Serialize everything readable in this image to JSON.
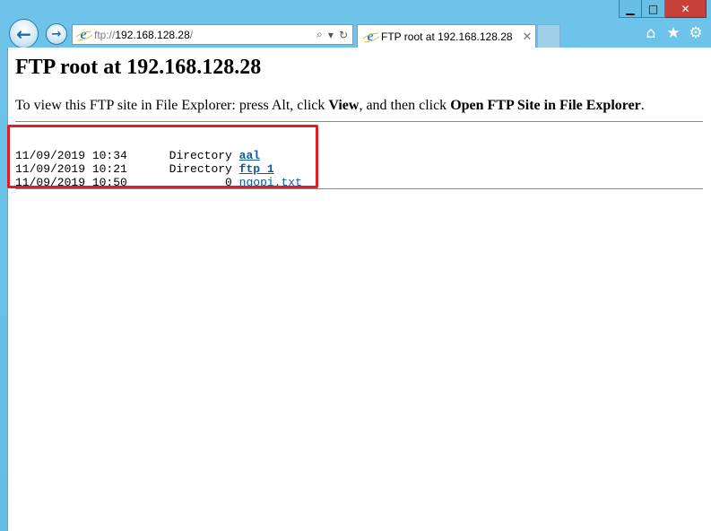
{
  "window": {
    "minimize_label": "▁",
    "maximize_label": "□",
    "close_label": "✕"
  },
  "nav": {
    "back_label": "←",
    "forward_label": "→"
  },
  "address": {
    "prefix": "ftp://",
    "host": "192.168.128.28",
    "suffix": "/",
    "search_glyph": "⌕",
    "dropdown_glyph": "▾",
    "refresh_glyph": "↻"
  },
  "tab": {
    "title": "FTP root at 192.168.128.28",
    "close_glyph": "✕"
  },
  "toolbar_icons": {
    "home": "⌂",
    "favorites": "★",
    "settings": "⚙"
  },
  "page": {
    "title": "FTP root at 192.168.128.28",
    "instr_1": "To view this FTP site in File Explorer: press Alt, click ",
    "instr_view": "View",
    "instr_2": ", and then click ",
    "instr_open": "Open FTP Site in File Explorer",
    "instr_3": "."
  },
  "listing": [
    {
      "date": "11/09/2019 10:34",
      "type": "Directory",
      "name": "aal"
    },
    {
      "date": "11/09/2019 10:21",
      "type": "Directory",
      "name": "ftp 1"
    },
    {
      "date": "11/09/2019 10:50",
      "type": "0",
      "name": "ngopi.txt"
    }
  ],
  "colors": {
    "highlight_border": "#e11c24",
    "link": "#0b5aa3",
    "chrome": "#62bde6"
  }
}
